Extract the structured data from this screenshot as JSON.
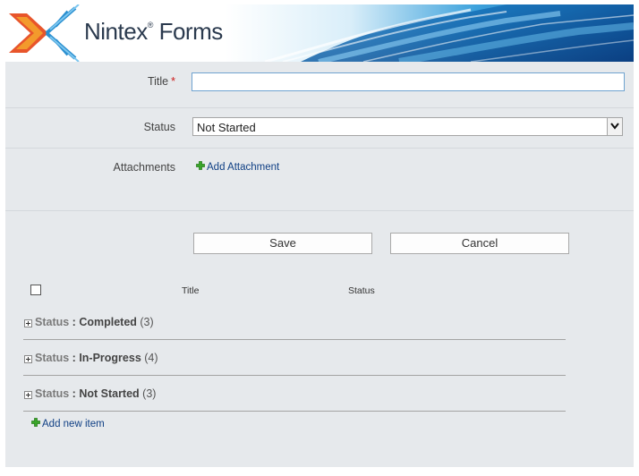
{
  "banner": {
    "brand": "Nintex",
    "brand_mark": "®",
    "brand_suffix": "Forms"
  },
  "form": {
    "title_label": "Title",
    "required_mark": "*",
    "title_value": "",
    "status_label": "Status",
    "status_value": "Not Started",
    "attachments_label": "Attachments",
    "add_attachment": "Add Attachment",
    "save_label": "Save",
    "cancel_label": "Cancel"
  },
  "list": {
    "columns": [
      "Title",
      "Status"
    ],
    "groups": [
      {
        "field": "Status",
        "sep": " : ",
        "value": "Completed",
        "count": "(3)"
      },
      {
        "field": "Status",
        "sep": " : ",
        "value": "In-Progress",
        "count": "(4)"
      },
      {
        "field": "Status",
        "sep": " : ",
        "value": "Not Started",
        "count": "(3)"
      }
    ],
    "add_new": "Add new item"
  },
  "colors": {
    "accent_blue": "#0f3f84",
    "banner_blue": "#0e63b8",
    "logo_orange": "#e8552b"
  }
}
